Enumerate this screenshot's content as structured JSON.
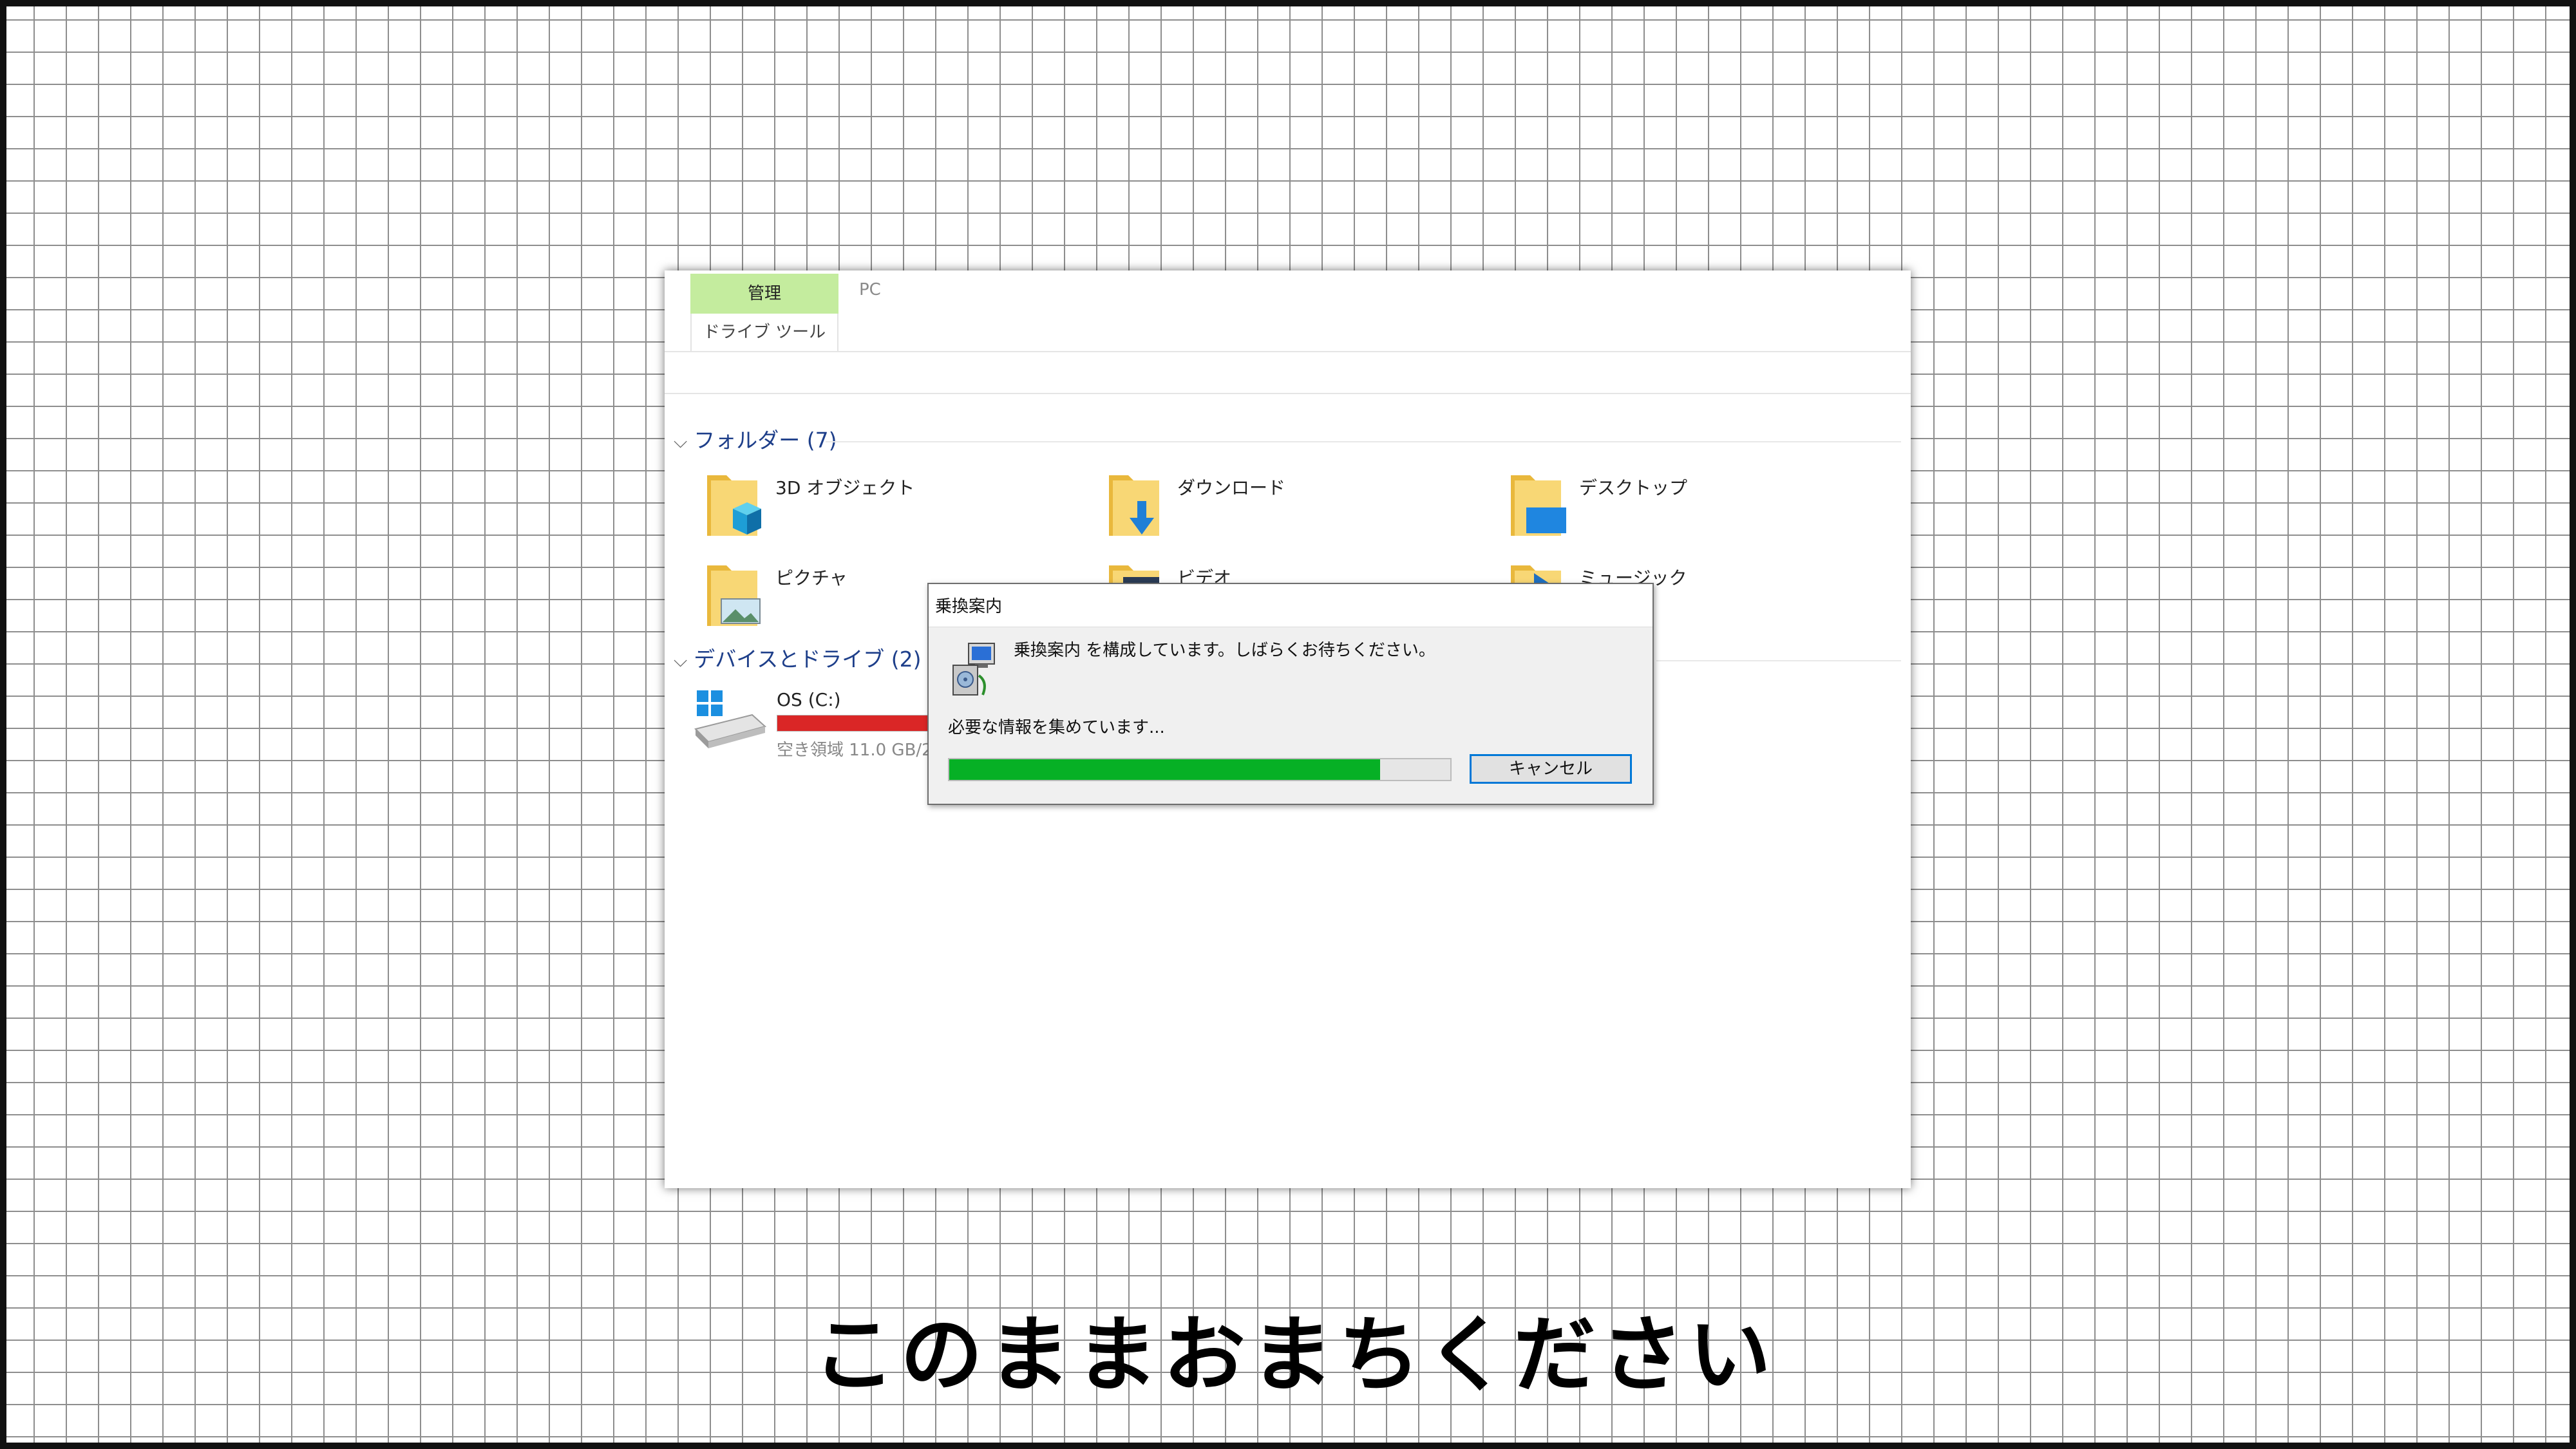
{
  "ribbon": {
    "manage_tab": "管理",
    "drive_tools_tab": "ドライブ ツール",
    "pc_tab": "PC"
  },
  "folders_section": {
    "heading": "フォルダー (7)",
    "items": [
      {
        "label": "3D オブジェクト",
        "icon": "3d-objects-folder-icon"
      },
      {
        "label": "ダウンロード",
        "icon": "downloads-folder-icon"
      },
      {
        "label": "デスクトップ",
        "icon": "desktop-folder-icon"
      },
      {
        "label": "ピクチャ",
        "icon": "pictures-folder-icon"
      },
      {
        "label": "ビデオ",
        "icon": "videos-folder-icon"
      },
      {
        "label": "ミュージック",
        "icon": "music-folder-icon"
      }
    ]
  },
  "devices_section": {
    "heading": "デバイスとドライブ (2)",
    "drive": {
      "label": "OS (C:)",
      "free_text": "空き領域 11.0 GB/2",
      "used_fraction": 0.95,
      "bar_color": "#da2626"
    }
  },
  "dialog": {
    "title": "乗換案内",
    "message": "乗換案内 を構成しています。しばらくお待ちください。",
    "status": "必要な情報を集めています...",
    "progress_fraction": 0.86,
    "progress_color": "#06b025",
    "cancel_label": "キャンセル"
  },
  "caption": "このままおまちください"
}
